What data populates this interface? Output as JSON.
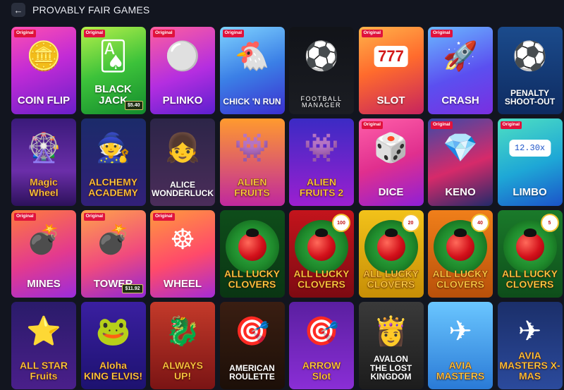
{
  "header": {
    "back_icon": "arrow-left-icon",
    "title": "PROVABLY FAIR GAMES"
  },
  "badge_label": "Original",
  "games": [
    {
      "name": "COIN FLIP",
      "original": true,
      "icon": "coin-icon",
      "bg": "linear-gradient(160deg,#ff4fb0 0%,#c12bd6 45%,#6a1fc9 100%)",
      "glyph": "🪙"
    },
    {
      "name": "BLACK\nJACK",
      "original": true,
      "icon": "playing-card-icon",
      "price": "$5.40",
      "bg": "linear-gradient(160deg,#b6f04a 0%,#3cc23a 50%,#138a2d 100%)",
      "glyph": "🂡"
    },
    {
      "name": "PLINKO",
      "original": true,
      "icon": "plinko-icon",
      "bg": "linear-gradient(160deg,#ff5f9e 0%,#b42ee0 55%,#5c1fcf 100%)",
      "glyph": "⚪"
    },
    {
      "name": "CHICK 'N RUN",
      "original": true,
      "icon": "chicken-icon",
      "bg": "linear-gradient(160deg,#7fd3ff 0%,#3b7fe6 50%,#3b2fd0 100%)",
      "glyph": "🐔",
      "small": true
    },
    {
      "name": "FOOTBALL\nMANAGER",
      "original": false,
      "icon": "football-player-icon",
      "bg": "linear-gradient(180deg,#111318 0%,#1b1d23 100%)",
      "glyph": "⚽",
      "sub": true
    },
    {
      "name": "SLOT",
      "original": true,
      "icon": "slot-machine-icon",
      "bg": "linear-gradient(160deg,#ffb34a 0%,#ff6b2d 45%,#c6235e 100%)",
      "glyph": "777"
    },
    {
      "name": "CRASH",
      "original": true,
      "icon": "rocket-icon",
      "bg": "linear-gradient(160deg,#6ab8ff 0%,#5b4ff0 55%,#7a2ee0 100%)",
      "glyph": "🚀"
    },
    {
      "name": "PENALTY\nSHOOT-OUT",
      "original": false,
      "icon": "soccer-player-icon",
      "bg": "linear-gradient(180deg,#1b4b8c 0%,#0e2b61 100%)",
      "glyph": "⚽",
      "small": true
    },
    {
      "name": "Magic\nWheel",
      "original": false,
      "icon": "magic-wheel-icon",
      "bg": "linear-gradient(180deg,#3a1a7a 0%,#6b2ea9 60%,#2c115a 100%)",
      "glyph": "🎡",
      "stylized": true
    },
    {
      "name": "ALCHEMY\nACADEMY",
      "original": false,
      "icon": "witch-icon",
      "bg": "linear-gradient(180deg,#1b2b6a 0%,#322078 100%)",
      "glyph": "🧙",
      "stylized": true,
      "small": true
    },
    {
      "name": "ALICE\nWONDERLUCK",
      "original": false,
      "icon": "alice-icon",
      "bg": "linear-gradient(180deg,#2c2548 0%,#4b2d5a 100%)",
      "glyph": "👧",
      "small": true
    },
    {
      "name": "ALIEN\nFRUITS",
      "original": false,
      "icon": "alien-fruit-icon",
      "bg": "linear-gradient(180deg,#ff9a2e 0%,#c0289e 100%)",
      "glyph": "👾",
      "stylized": true
    },
    {
      "name": "ALIEN\nFRUITS 2",
      "original": false,
      "icon": "alien-fruit-icon",
      "bg": "linear-gradient(180deg,#3b2ac4 0%,#9c1fd0 100%)",
      "glyph": "👾",
      "stylized": true
    },
    {
      "name": "DICE",
      "original": true,
      "icon": "dice-icon",
      "bg": "linear-gradient(160deg,#ff5fa9 0%,#e02f8e 50%,#8f1fd6 100%)",
      "glyph": "🎲"
    },
    {
      "name": "KENO",
      "original": true,
      "icon": "gem-icon",
      "bg": "linear-gradient(160deg,#3c4aa8 0%,#d62a6a 55%,#222a6a 100%)",
      "glyph": "💎"
    },
    {
      "name": "LIMBO",
      "original": true,
      "icon": "multiplier-icon",
      "bg": "linear-gradient(160deg,#4ee0c2 0%,#1ea7d6 55%,#1b53c9 100%)",
      "glyph": "12.30x"
    },
    {
      "name": "MINES",
      "original": true,
      "icon": "mine-icon",
      "bg": "linear-gradient(160deg,#ff7b3d 0%,#e33a8e 55%,#9b2cdc 100%)",
      "glyph": "💣"
    },
    {
      "name": "TOWER",
      "original": true,
      "icon": "bomb-icon",
      "price": "$11.92",
      "bg": "linear-gradient(160deg,#ffa24a 0%,#f04a7e 55%,#8f27d6 100%)",
      "glyph": "💣"
    },
    {
      "name": "WHEEL",
      "original": true,
      "icon": "wheel-icon",
      "bg": "linear-gradient(160deg,#ff9a3d 0%,#ff4a6a 55%,#a52bd6 100%)",
      "glyph": "☸"
    },
    {
      "name": "ALL LUCKY\nCLOVERS",
      "original": false,
      "icon": "ladybug-icon",
      "bg": "linear-gradient(180deg,#0e4d1a 0%,#0a3513 100%)",
      "clover": true,
      "stylized": true,
      "small": true
    },
    {
      "name": "ALL LUCKY\nCLOVERS",
      "original": false,
      "icon": "ladybug-icon",
      "lines": "100",
      "bg": "linear-gradient(180deg,#c4141c 0%,#7d0a12 100%)",
      "clover": true,
      "stylized": true,
      "small": true
    },
    {
      "name": "ALL LUCKY\nCLOVERS",
      "original": false,
      "icon": "ladybug-icon",
      "lines": "20",
      "bg": "linear-gradient(180deg,#f2c21a 0%,#c78e06 100%)",
      "clover": true,
      "stylized": true,
      "small": true
    },
    {
      "name": "ALL LUCKY\nCLOVERS",
      "original": false,
      "icon": "ladybug-icon",
      "lines": "40",
      "bg": "linear-gradient(180deg,#f07f1a 0%,#b8500a 100%)",
      "clover": true,
      "stylized": true,
      "small": true
    },
    {
      "name": "ALL LUCKY\nCLOVERS",
      "original": false,
      "icon": "ladybug-icon",
      "lines": "5",
      "bg": "linear-gradient(180deg,#1a7a2a 0%,#0e4d1a 100%)",
      "clover": true,
      "stylized": true,
      "small": true
    },
    {
      "name": "ALL STAR\nFruits",
      "original": false,
      "icon": "star-fruit-icon",
      "bg": "linear-gradient(180deg,#2a1b6a 0%,#4a1f8a 100%)",
      "glyph": "⭐",
      "stylized": true
    },
    {
      "name": "Aloha\nKING ELVIS!",
      "original": false,
      "icon": "frog-icon",
      "bg": "linear-gradient(180deg,#3a1fa0 0%,#1d1270 100%)",
      "glyph": "🐸",
      "stylized": true,
      "small": true
    },
    {
      "name": "ALWAYS\nUP!",
      "original": false,
      "icon": "dragon-icon",
      "bg": "linear-gradient(180deg,#c43a2a 0%,#7a1414 100%)",
      "glyph": "🐉",
      "stylized": true
    },
    {
      "name": "AMERICAN\nROULETTE",
      "original": false,
      "icon": "roulette-icon",
      "bg": "linear-gradient(180deg,#3a1e12 0%,#1c0f08 100%)",
      "glyph": "🎯",
      "small": true
    },
    {
      "name": "ARROW\nSlot",
      "original": false,
      "icon": "arrow-wheel-icon",
      "bg": "linear-gradient(180deg,#5a1fa0 0%,#8a2ed6 100%)",
      "glyph": "🎯",
      "stylized": true
    },
    {
      "name": "AVALON\nTHE LOST KINGDOM",
      "original": false,
      "icon": "sorceress-icon",
      "bg": "linear-gradient(180deg,#3a3a3a 0%,#1c1c1c 100%)",
      "glyph": "👸",
      "small": true
    },
    {
      "name": "AVIA\nMASTERS",
      "original": false,
      "icon": "airplane-icon",
      "bg": "linear-gradient(180deg,#6ac6ff 0%,#2a7ad6 100%)",
      "glyph": "✈",
      "stylized": true
    },
    {
      "name": "AVIA\nMASTERS X-MAS",
      "original": false,
      "icon": "airplane-icon",
      "bg": "linear-gradient(180deg,#1b2f6a 0%,#2b4a9c 100%)",
      "glyph": "✈",
      "stylized": true,
      "small": true
    }
  ]
}
